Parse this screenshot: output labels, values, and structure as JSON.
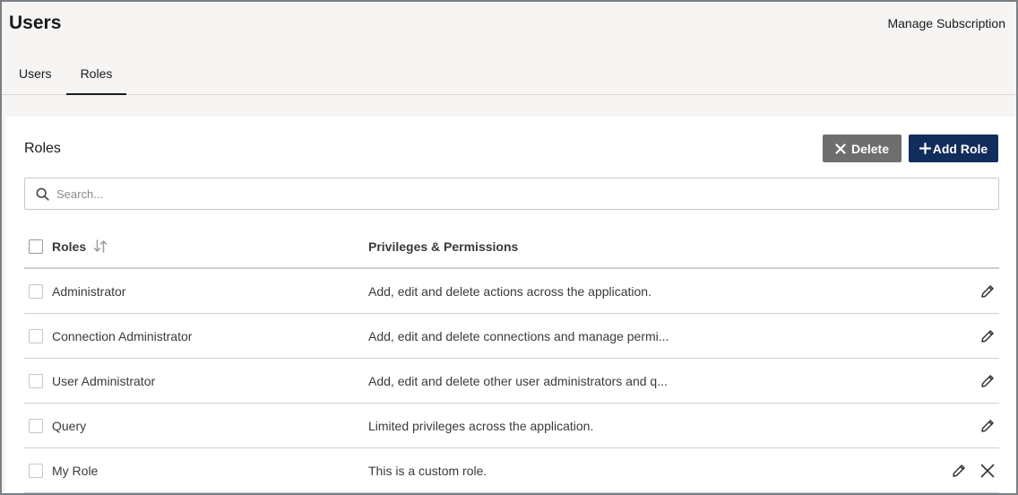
{
  "header": {
    "title": "Users",
    "manage_subscription": "Manage Subscription",
    "tabs": [
      {
        "label": "Users",
        "active": false
      },
      {
        "label": "Roles",
        "active": true
      }
    ]
  },
  "roles_panel": {
    "title": "Roles",
    "delete_label": "Delete",
    "add_role_label": "Add Role",
    "search": {
      "placeholder": "Search...",
      "value": "",
      "icon": "search-icon"
    },
    "columns": {
      "role": "Roles",
      "privileges": "Privileges & Permissions"
    },
    "rows": [
      {
        "role": "Administrator",
        "privileges": "Add, edit and delete actions across the application.",
        "deletable": false
      },
      {
        "role": "Connection Administrator",
        "privileges": "Add, edit and delete connections and manage permi...",
        "deletable": false
      },
      {
        "role": "User Administrator",
        "privileges": "Add, edit and delete other user administrators and q...",
        "deletable": false
      },
      {
        "role": "Query",
        "privileges": "Limited privileges across the application.",
        "deletable": false
      },
      {
        "role": "My Role",
        "privileges": "This is a custom role.",
        "deletable": true
      }
    ]
  },
  "colors": {
    "accent": "#112d5c",
    "delete_button": "#6e6e6e",
    "background": "#f7f5f3",
    "panel": "#ffffff"
  }
}
